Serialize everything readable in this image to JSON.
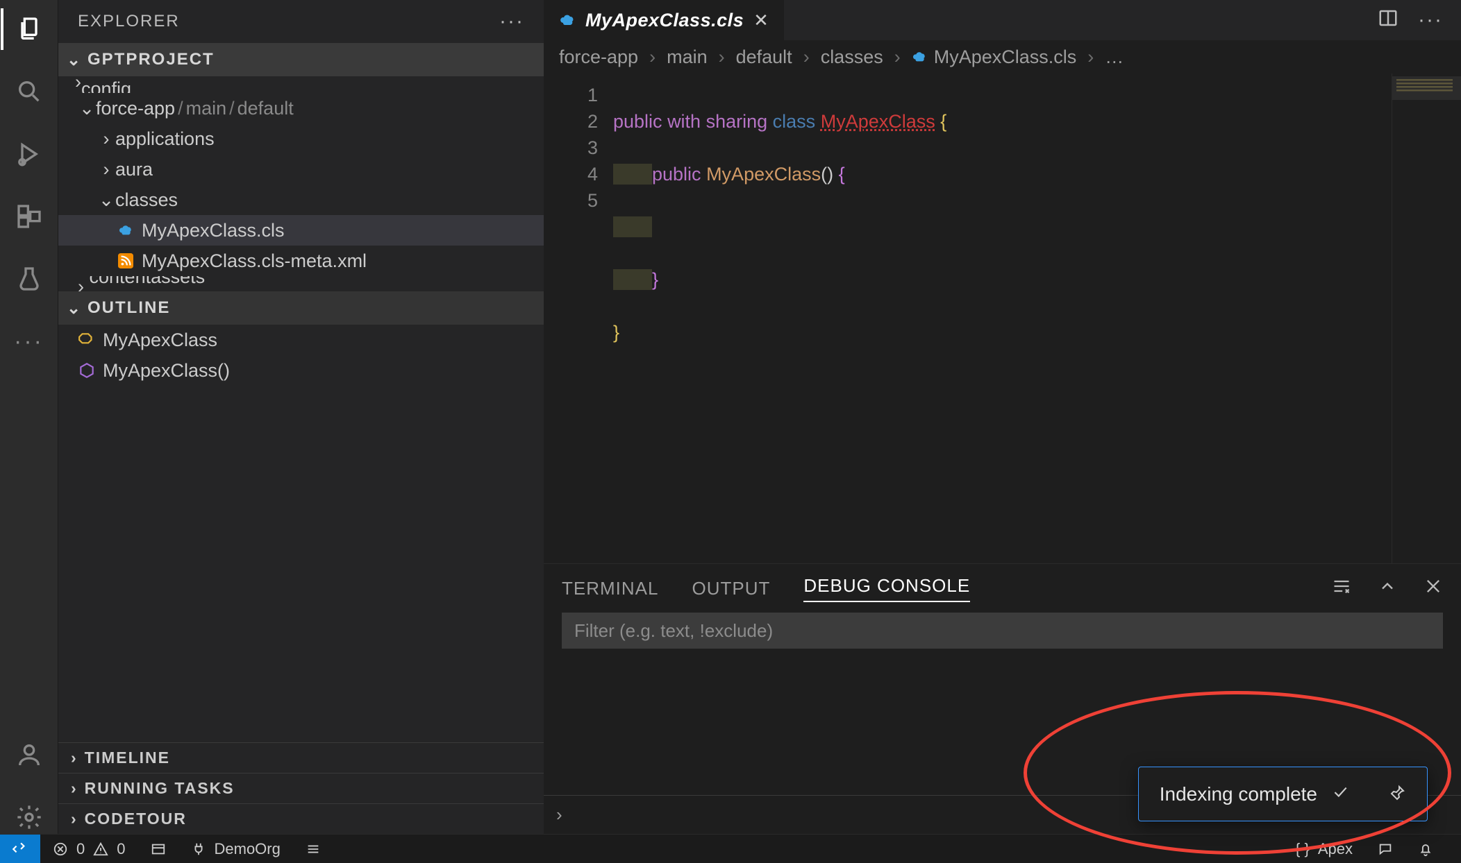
{
  "sidebar": {
    "title": "EXPLORER",
    "sections": {
      "project": "GPTPROJECT",
      "outline": "OUTLINE",
      "timeline": "TIMELINE",
      "running_tasks": "RUNNING TASKS",
      "codetour": "CODETOUR"
    },
    "tree": {
      "cutoff_top": "config",
      "force_app": {
        "name": "force-app",
        "seg2": "main",
        "seg3": "default"
      },
      "applications": "applications",
      "aura": "aura",
      "classes": "classes",
      "file_cls": "MyApexClass.cls",
      "file_meta": "MyApexClass.cls-meta.xml",
      "cutoff_bot": "contentassets"
    },
    "outline_items": {
      "class": "MyApexClass",
      "ctor": "MyApexClass()"
    }
  },
  "tabs": {
    "active": "MyApexClass.cls"
  },
  "breadcrumbs": [
    "force-app",
    "main",
    "default",
    "classes",
    "MyApexClass.cls",
    "…"
  ],
  "code": {
    "lines": [
      "1",
      "2",
      "3",
      "4",
      "5"
    ],
    "tokens": {
      "public": "public",
      "with": "with",
      "sharing": "sharing",
      "class": "class",
      "type": "MyApexClass",
      "ctor": "MyApexClass",
      "lbrace": "{",
      "rbrace": "}",
      "paren": "()"
    }
  },
  "panel": {
    "terminal": "TERMINAL",
    "output": "OUTPUT",
    "debug": "DEBUG CONSOLE",
    "filter_placeholder": "Filter (e.g. text, !exclude)"
  },
  "status": {
    "errors": "0",
    "warnings": "0",
    "org": "DemoOrg",
    "lang": "Apex"
  },
  "notification": {
    "text": "Indexing complete"
  }
}
